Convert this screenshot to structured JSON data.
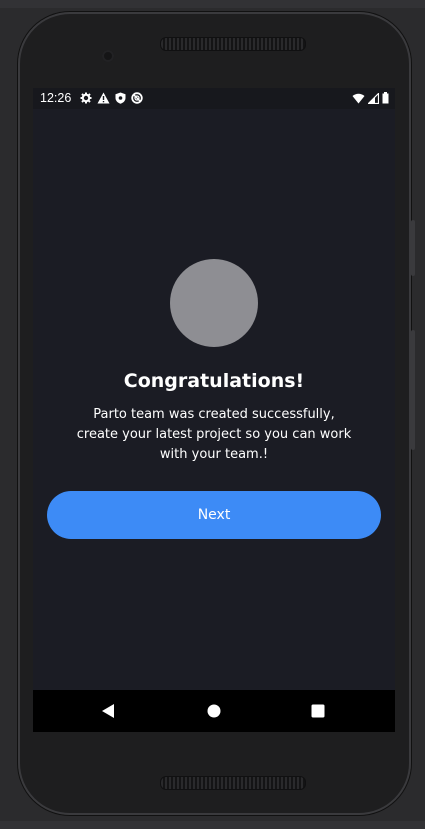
{
  "status_bar": {
    "time": "12:26",
    "left_icons": [
      "gear-icon",
      "warning-icon",
      "shield-icon",
      "no-sync-icon"
    ],
    "right_icons": [
      "wifi-icon",
      "signal-icon",
      "battery-icon"
    ]
  },
  "content": {
    "title": "Congratulations!",
    "message_line1": "Parto team was created successfully,",
    "message_line2": "create your latest project so you can work",
    "message_line3": "with your team.!",
    "next_label": "Next"
  },
  "navigation": {
    "buttons": [
      "back-icon",
      "home-icon",
      "recents-icon"
    ]
  },
  "colors": {
    "screen_background": "#1b1c24",
    "accent": "#3d8bf6",
    "avatar_placeholder": "#8e8e93",
    "text": "#ffffff"
  }
}
